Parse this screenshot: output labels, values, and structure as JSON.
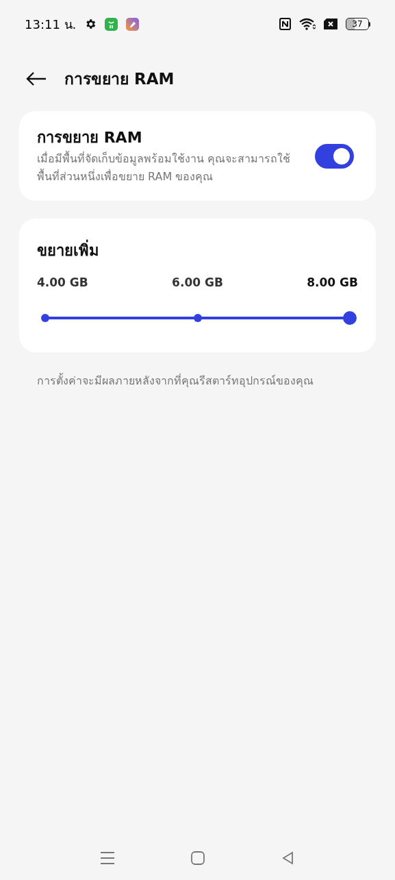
{
  "status_bar": {
    "time": "13:11 น.",
    "battery": "37"
  },
  "header": {
    "title": "การขยาย RAM"
  },
  "ram_card": {
    "title": "การขยาย RAM",
    "description": "เมื่อมีพื้นที่จัดเก็บข้อมูลพร้อมใช้งาน คุณจะสามารถใช้พื้นที่ส่วนหนึ่งเพื่อขยาย RAM ของคุณ",
    "on": true
  },
  "size_card": {
    "title": "ขยายเพิ่ม",
    "stops": [
      {
        "label": "4.00 GB",
        "selected": false
      },
      {
        "label": "6.00 GB",
        "selected": false
      },
      {
        "label": "8.00 GB",
        "selected": true
      }
    ]
  },
  "note": "การตั้งค่าจะมีผลภายหลังจากที่คุณรีสตาร์ทอุปกรณ์ของคุณ"
}
